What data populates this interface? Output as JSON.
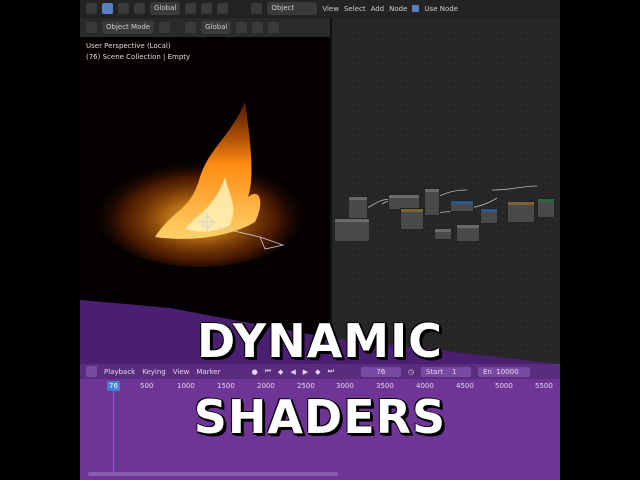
{
  "topbar": {
    "left_transform": "Global",
    "editor_mode": "Object",
    "menus": [
      "View",
      "Select",
      "Add",
      "Node"
    ],
    "use_nodes_label": "Use Node"
  },
  "viewport_header": {
    "mode": "Object Mode",
    "transform": "Global"
  },
  "viewport_info": {
    "line1": "User Perspective (Local)",
    "line2": "(76) Scene Collection | Empty"
  },
  "timeline": {
    "menus": [
      "Playback",
      "Keying",
      "View",
      "Marker"
    ],
    "current_frame": "76",
    "start_label": "Start",
    "start_value": "1",
    "end_label": "En",
    "end_value": "10000",
    "frame_marker": "76",
    "ruler": [
      "500",
      "1000",
      "1500",
      "2000",
      "2500",
      "3000",
      "3500",
      "4000",
      "4500",
      "5000",
      "5500"
    ]
  },
  "overlay": {
    "line1": "DYNAMIC",
    "line2": "SHADERS"
  },
  "colors": {
    "accent": "#5680c2",
    "timeline": "#6e3596",
    "fire": "#ff9a1a"
  }
}
